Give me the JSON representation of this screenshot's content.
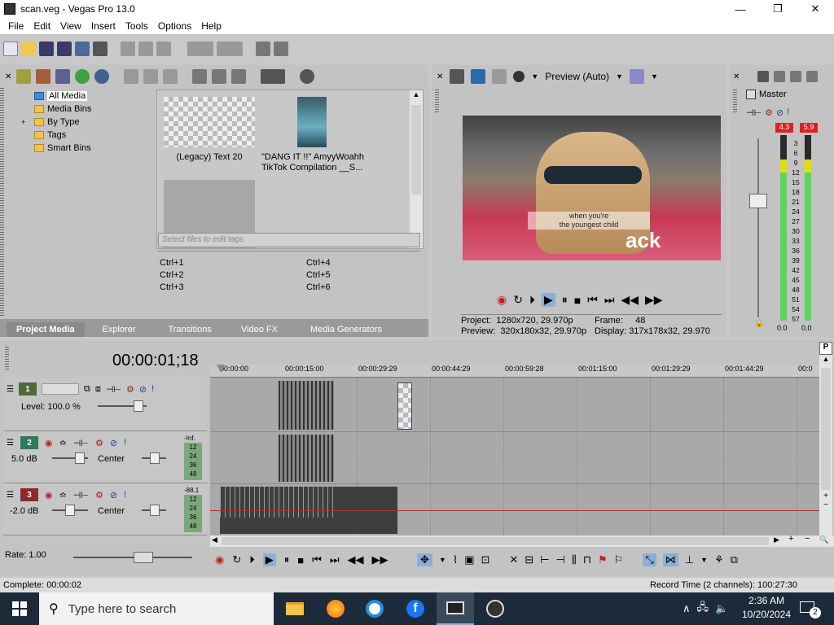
{
  "window": {
    "title": "scan.veg - Vegas Pro 13.0",
    "minimize": "—",
    "maximize": "❐",
    "close": "✕"
  },
  "menu": [
    "File",
    "Edit",
    "View",
    "Insert",
    "Tools",
    "Options",
    "Help"
  ],
  "media_tree": {
    "items": [
      {
        "label": "All Media",
        "selected": true
      },
      {
        "label": "Media Bins"
      },
      {
        "label": "By Type",
        "expandable": true
      },
      {
        "label": "Tags"
      },
      {
        "label": "Smart Bins"
      }
    ],
    "expand_symbol": "+"
  },
  "media_items": [
    {
      "label": "(Legacy) Text 20"
    },
    {
      "label": "\"DANG IT !!\" AmyyWoahh TikTok Compilation __S..."
    }
  ],
  "tags": {
    "placeholder": "Select files to edit tags",
    "shortcuts_left": [
      "Ctrl+1",
      "Ctrl+2",
      "Ctrl+3"
    ],
    "shortcuts_right": [
      "Ctrl+4",
      "Ctrl+5",
      "Ctrl+6"
    ]
  },
  "bottom_tabs": [
    "Project Media",
    "Explorer",
    "Transitions",
    "Video FX",
    "Media Generators"
  ],
  "preview": {
    "mode": "Preview (Auto)",
    "project_label": "Project:",
    "project_value": "1280x720, 29.970p",
    "preview_label": "Preview:",
    "preview_value": "320x180x32, 29.970p",
    "frame_label": "Frame:",
    "frame_value": "48",
    "display_label": "Display:",
    "display_value": "317x178x32, 29.970",
    "overlay_text_1": "when you're",
    "overlay_text_2": "the youngest child",
    "shirt_text": "ack"
  },
  "master": {
    "label": "Master",
    "peak_left": "4.3",
    "peak_right": "5.9",
    "scale": [
      "3",
      "6",
      "9",
      "12",
      "15",
      "18",
      "21",
      "24",
      "27",
      "30",
      "33",
      "36",
      "39",
      "42",
      "45",
      "48",
      "51",
      "54",
      "57"
    ],
    "value_left": "0.0",
    "value_right": "0.0"
  },
  "timeline": {
    "timecode": "00:00:01;18",
    "ruler": [
      "00:00:00",
      "00:00:15:00",
      "00:00:29:29",
      "00:00:44:29",
      "00:00:59:28",
      "00:01:15:00",
      "00:01:29:29",
      "00:01:44:29",
      "00:0"
    ],
    "tracks": [
      {
        "num": "1",
        "type": "video",
        "level": "Level: 100.0 %"
      },
      {
        "num": "2",
        "type": "audio",
        "volume": "5.0 dB",
        "pan": "Center",
        "meter_top": "-Inf."
      },
      {
        "num": "3",
        "type": "audio",
        "volume": "-2.0 dB",
        "pan": "Center",
        "meter_top": "-88.1"
      }
    ],
    "meter_scale": [
      "12",
      "24",
      "36",
      "48"
    ],
    "rate": "Rate: 1.00"
  },
  "status": {
    "complete": "Complete: 00:00:02",
    "record_time": "Record Time (2 channels): 100:27:30"
  },
  "taskbar": {
    "search_placeholder": "Type here to search",
    "time": "2:36 AM",
    "date": "10/20/2024",
    "notification_count": "2"
  },
  "colors": {
    "accent": "#0078d7",
    "track_video": "#4e8a3a",
    "track_audio": "#2f7a5a",
    "track_audio3": "#8a2a2a",
    "peak_red": "#e02020",
    "meter_green": "#5ad65a"
  }
}
